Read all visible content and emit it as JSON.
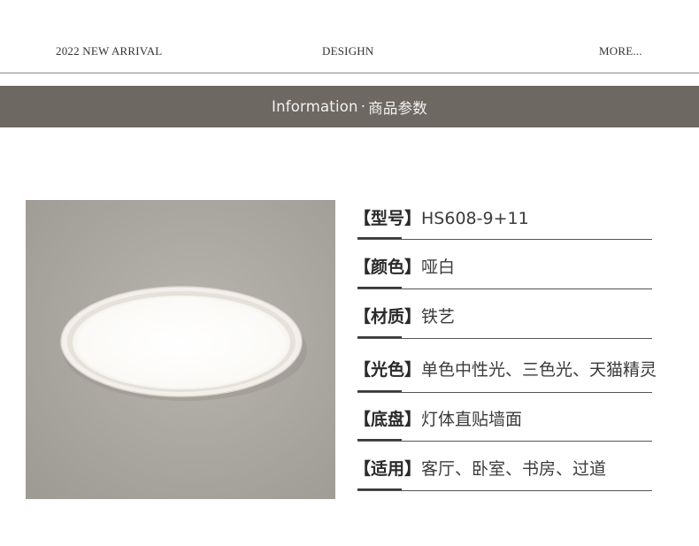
{
  "nav": {
    "left": "2022 NEW ARRIVAL",
    "center": "DESIGHN",
    "right": "MORE..."
  },
  "banner": {
    "en": "Information",
    "dot": "·",
    "cn": "商品参数"
  },
  "specs": [
    {
      "key": "【型号】",
      "value": "HS608-9+11"
    },
    {
      "key": "【颜色】",
      "value": "哑白"
    },
    {
      "key": "【材质】",
      "value": "铁艺"
    },
    {
      "key": "【光色】",
      "value": "单色中性光、三色光、天猫精灵"
    },
    {
      "key": "【底盘】",
      "value": "灯体直贴墙面"
    },
    {
      "key": "【适用】",
      "value": "客厅、卧室、书房、过道"
    }
  ],
  "colors": {
    "banner_bg": "#6d6862",
    "photo_bg": "#a9a5a0",
    "lamp_rim": "#f2efea"
  }
}
